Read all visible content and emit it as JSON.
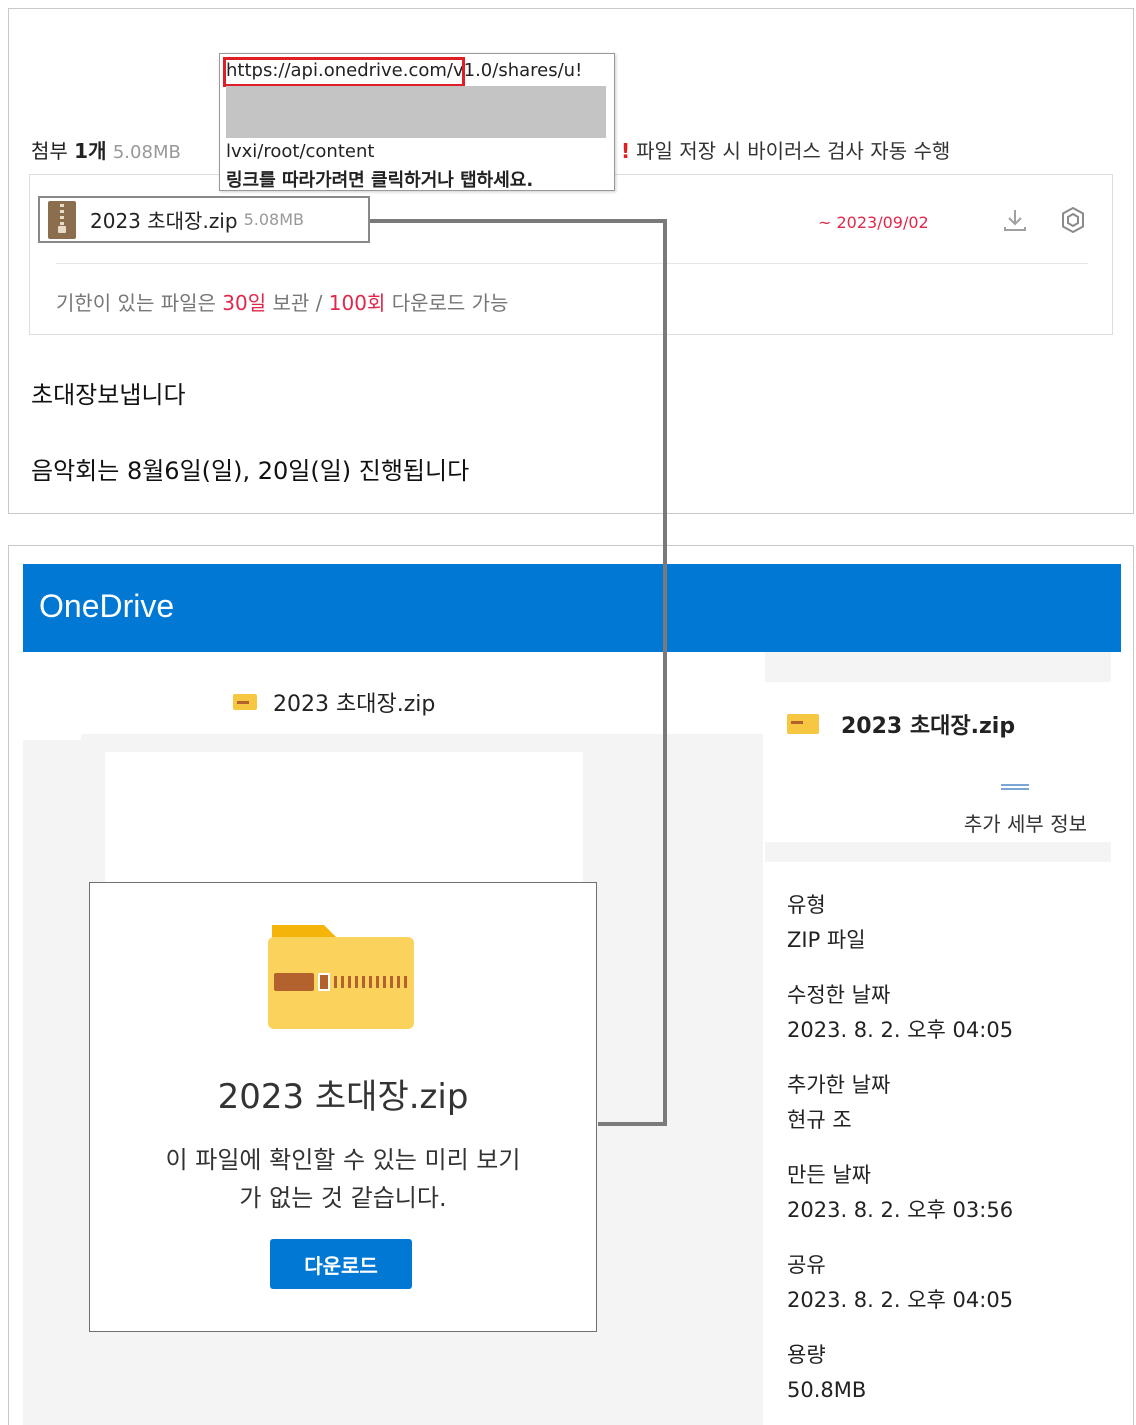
{
  "email": {
    "attachment_header": {
      "prefix": "첨부",
      "count": "1개",
      "size": "5.08MB"
    },
    "scan_note": {
      "mark": "!",
      "text": "파일 저장 시 바이러스 검사 자동 수행"
    },
    "attachment": {
      "file_name": "2023 초대장.zip",
      "file_size": "5.08MB",
      "expiry": "~ 2023/09/02",
      "download_icon": "download-icon",
      "scan_icon": "shield-scan-icon"
    },
    "retention": {
      "part1": "기한이 있는 파일은 ",
      "days": "30일",
      "part2": " 보관 / ",
      "count": "100회",
      "part3": " 다운로드 가능"
    },
    "body_lines": [
      "초대장보냅니다",
      "음악회는 8월6일(일), 20일(일) 진행됩니다"
    ],
    "link_tooltip": {
      "url_start": "https://api.onedrive.com/v1.0/shares/u!",
      "url_end": "lvxi/root/content",
      "hint": "링크를 따라가려면 클릭하거나 탭하세요."
    }
  },
  "onedrive": {
    "brand": "OneDrive",
    "breadcrumb_file": "2023 초대장.zip",
    "preview": {
      "file_name": "2023 초대장.zip",
      "message_line1": "이 파일에 확인할 수 있는 미리 보기",
      "message_line2": "가 없는 것 같습니다.",
      "download_label": "다운로드"
    },
    "details_panel": {
      "file_name": "2023 초대장.zip",
      "more_details": "추가 세부 정보",
      "fields": [
        {
          "label": "유형",
          "value": "ZIP 파일"
        },
        {
          "label": "수정한 날짜",
          "value": "2023. 8. 2. 오후 04:05"
        },
        {
          "label": "추가한 날짜",
          "value": "현규 조"
        },
        {
          "label": "만든 날짜",
          "value": "2023. 8. 2. 오후 03:56"
        },
        {
          "label": "공유",
          "value": "2023. 8. 2. 오후 04:05"
        },
        {
          "label": "용량",
          "value": "50.8MB"
        }
      ]
    }
  },
  "colors": {
    "onedrive_blue": "#0078d4",
    "highlight_red": "#e01e25",
    "accent_red": "#e0284a",
    "folder_yellow": "#f8c742"
  }
}
